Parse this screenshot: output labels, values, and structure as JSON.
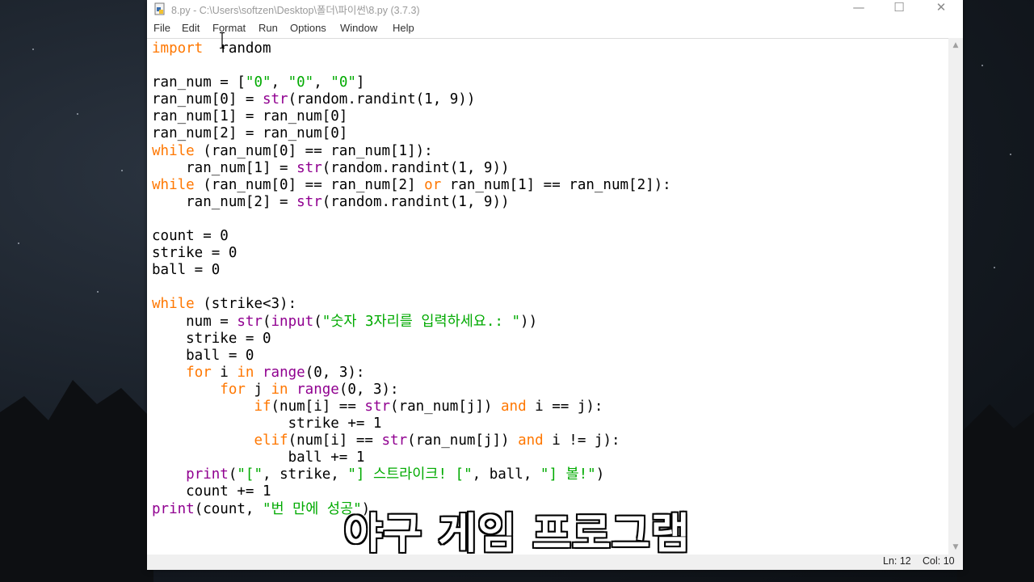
{
  "window": {
    "title": "8.py - C:\\Users\\softzen\\Desktop\\폴더\\파이썬\\8.py (3.7.3)",
    "controls": {
      "minimize": "—",
      "maximize": "☐",
      "close": "✕"
    }
  },
  "menu": [
    "File",
    "Edit",
    "Format",
    "Run",
    "Options",
    "Window",
    "Help"
  ],
  "status": {
    "line": "Ln: 12",
    "col": "Col: 10"
  },
  "caption": "야구 게임 프로그램",
  "colors": {
    "keyword": "#ff7700",
    "builtin": "#900090",
    "string": "#00aa00",
    "text": "#000000"
  },
  "code_lines": [
    [
      [
        "kw",
        "import"
      ],
      [
        "",
        "  random"
      ]
    ],
    [],
    [
      [
        "",
        "ran_num = ["
      ],
      [
        "st",
        "\"0\""
      ],
      [
        "",
        ", "
      ],
      [
        "st",
        "\"0\""
      ],
      [
        "",
        ", "
      ],
      [
        "st",
        "\"0\""
      ],
      [
        "",
        "]"
      ]
    ],
    [
      [
        "",
        "ran_num[0] = "
      ],
      [
        "bi",
        "str"
      ],
      [
        "",
        "(random.randint(1, 9))"
      ]
    ],
    [
      [
        "",
        "ran_num[1] = ran_num[0]"
      ]
    ],
    [
      [
        "",
        "ran_num[2] = ran_num[0]"
      ]
    ],
    [
      [
        "kw",
        "while"
      ],
      [
        "",
        " (ran_num[0] == ran_num[1]):"
      ]
    ],
    [
      [
        "",
        "    ran_num[1] = "
      ],
      [
        "bi",
        "str"
      ],
      [
        "",
        "(random.randint(1, 9))"
      ]
    ],
    [
      [
        "kw",
        "while"
      ],
      [
        "",
        " (ran_num[0] == ran_num[2] "
      ],
      [
        "kw",
        "or"
      ],
      [
        "",
        " ran_num[1] == ran_num[2]):"
      ]
    ],
    [
      [
        "",
        "    ran_num[2] = "
      ],
      [
        "bi",
        "str"
      ],
      [
        "",
        "(random.randint(1, 9))"
      ]
    ],
    [],
    [
      [
        "",
        "count = 0"
      ]
    ],
    [
      [
        "",
        "strike = 0"
      ]
    ],
    [
      [
        "",
        "ball = 0"
      ]
    ],
    [],
    [
      [
        "kw",
        "while"
      ],
      [
        "",
        " (strike<3):"
      ]
    ],
    [
      [
        "",
        "    num = "
      ],
      [
        "bi",
        "str"
      ],
      [
        "",
        "("
      ],
      [
        "bi",
        "input"
      ],
      [
        "",
        "("
      ],
      [
        "st",
        "\"숫자 3자리를 입력하세요.: \""
      ],
      [
        "",
        "))"
      ]
    ],
    [
      [
        "",
        "    strike = 0"
      ]
    ],
    [
      [
        "",
        "    ball = 0"
      ]
    ],
    [
      [
        "",
        "    "
      ],
      [
        "kw",
        "for"
      ],
      [
        "",
        " i "
      ],
      [
        "kw",
        "in"
      ],
      [
        "",
        " "
      ],
      [
        "bi",
        "range"
      ],
      [
        "",
        "(0, 3):"
      ]
    ],
    [
      [
        "",
        "        "
      ],
      [
        "kw",
        "for"
      ],
      [
        "",
        " j "
      ],
      [
        "kw",
        "in"
      ],
      [
        "",
        " "
      ],
      [
        "bi",
        "range"
      ],
      [
        "",
        "(0, 3):"
      ]
    ],
    [
      [
        "",
        "            "
      ],
      [
        "kw",
        "if"
      ],
      [
        "",
        "(num[i] == "
      ],
      [
        "bi",
        "str"
      ],
      [
        "",
        "(ran_num[j]) "
      ],
      [
        "kw",
        "and"
      ],
      [
        "",
        " i == j):"
      ]
    ],
    [
      [
        "",
        "                strike += 1"
      ]
    ],
    [
      [
        "",
        "            "
      ],
      [
        "kw",
        "elif"
      ],
      [
        "",
        "(num[i] == "
      ],
      [
        "bi",
        "str"
      ],
      [
        "",
        "(ran_num[j]) "
      ],
      [
        "kw",
        "and"
      ],
      [
        "",
        " i != j):"
      ]
    ],
    [
      [
        "",
        "                ball += 1"
      ]
    ],
    [
      [
        "",
        "    "
      ],
      [
        "bi",
        "print"
      ],
      [
        "",
        "("
      ],
      [
        "st",
        "\"[\""
      ],
      [
        "",
        ", strike, "
      ],
      [
        "st",
        "\"] 스트라이크! [\""
      ],
      [
        "",
        ", ball, "
      ],
      [
        "st",
        "\"] 볼!\""
      ],
      [
        "",
        ")"
      ]
    ],
    [
      [
        "",
        "    count += 1"
      ]
    ],
    [
      [
        "bi",
        "print"
      ],
      [
        "",
        "(count, "
      ],
      [
        "st",
        "\"번 만에 성공\""
      ],
      [
        "",
        ")"
      ]
    ]
  ]
}
